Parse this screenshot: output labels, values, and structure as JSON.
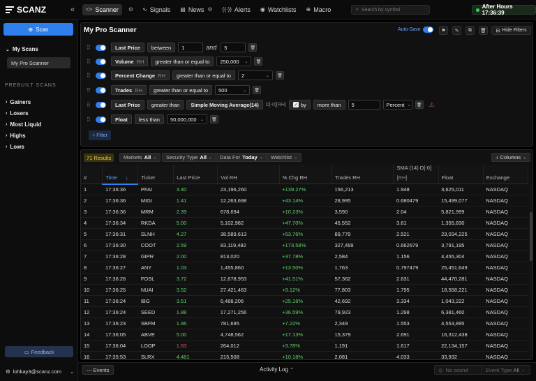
{
  "app": {
    "logo": "SCANZ"
  },
  "nav": [
    {
      "label": "Scanner",
      "icon": "code-icon",
      "active": true
    },
    {
      "label": "Signals",
      "icon": "pulse-icon"
    },
    {
      "label": "News",
      "icon": "news-icon"
    },
    {
      "label": "Alerts",
      "icon": "broadcast-icon"
    },
    {
      "label": "Watchlists",
      "icon": "eye-icon"
    },
    {
      "label": "Macro",
      "icon": "globe-icon"
    }
  ],
  "search": {
    "placeholder": "Search by symbol"
  },
  "market_status": "After Hours 17:36:39",
  "sidebar": {
    "scan_button": "Scan",
    "my_scans_label": "My Scans",
    "my_scans": [
      "My Pro Scanner"
    ],
    "prebuilt_label": "PREBUILT SCANS",
    "prebuilt": [
      "Gainers",
      "Losers",
      "Most Liquid",
      "Highs",
      "Lows"
    ],
    "feedback": "Feedback",
    "user_email": "lohkay3@scanz.com"
  },
  "scanner": {
    "title": "My Pro Scanner",
    "autosave_label": "Auto-Save",
    "hide_filters": "Hide Filters",
    "add_filter": "+ Filter",
    "filters": {
      "f1": {
        "field": "Last Price",
        "op": "between",
        "v1": "1",
        "and": "and",
        "v2": "5"
      },
      "f2": {
        "field": "Volume",
        "rh": "RH",
        "op": "greater than or equal to",
        "v1": "250,000"
      },
      "f3": {
        "field": "Percent Change",
        "rh": "RH",
        "op": "greater than or equal to",
        "v1": "2"
      },
      "f4": {
        "field": "Trades",
        "rh": "RH",
        "op": "greater than or equal to",
        "v1": "500"
      },
      "f5": {
        "field": "Last Price",
        "op": "greater than",
        "ind": "Simple Moving Average(14)",
        "ind_sub": "D[-0][RH]",
        "by": "by",
        "op2": "more than",
        "v1": "5",
        "unit": "Percent"
      },
      "f6": {
        "field": "Float",
        "op": "less than",
        "v1": "50,000,000"
      }
    }
  },
  "results": {
    "count_label": "71 Results",
    "chips": {
      "markets": {
        "label": "Markets",
        "value": "All"
      },
      "security": {
        "label": "Security Type",
        "value": "All"
      },
      "datafor": {
        "label": "Data For",
        "value": "Today"
      },
      "watchlist": {
        "label": "Watchlist",
        "value": ""
      }
    },
    "columns_btn": "Columns",
    "headers": {
      "num": "#",
      "time": "Time",
      "ticker": "Ticker",
      "last": "Last Price",
      "vol": "Vol RH",
      "pct": "% Chg RH",
      "trades": "Trades RH",
      "sma": "SMA (14) D[-0]",
      "sma_sub": "[RH]",
      "float": "Float",
      "exchange": "Exchange"
    },
    "rows": [
      [
        "1",
        "17:36:36",
        "PFAI",
        "3.40",
        "23,196,260",
        "+139.27%",
        "156,213",
        "1.948",
        "3,625,011",
        "NASDAQ"
      ],
      [
        "2",
        "17:36:36",
        "MIGI",
        "1.41",
        "12,263,698",
        "+43.14%",
        "28,995",
        "0.680479",
        "15,499,077",
        "NASDAQ"
      ],
      [
        "3",
        "17:36:36",
        "MRM",
        "2.39",
        "678,694",
        "+10.23%",
        "3,590",
        "2.04",
        "5,821,999",
        "NASDAQ"
      ],
      [
        "4",
        "17:36:34",
        "RKDA",
        "5.00",
        "5,102,982",
        "+47.70%",
        "45,552",
        "3.61",
        "1,355,830",
        "NASDAQ"
      ],
      [
        "5",
        "17:36:31",
        "SLNH",
        "4.27",
        "38,589,613",
        "+53.76%",
        "89,779",
        "2.521",
        "23,034,225",
        "NASDAQ"
      ],
      [
        "6",
        "17:36:30",
        "COOT",
        "2.59",
        "83,119,482",
        "+173.58%",
        "327,499",
        "0.662679",
        "3,791,195",
        "NASDAQ"
      ],
      [
        "7",
        "17:36:28",
        "GIPR",
        "2.00",
        "813,020",
        "+37.78%",
        "2,584",
        "1.156",
        "4,455,304",
        "NASDAQ"
      ],
      [
        "8",
        "17:36:27",
        "ANY",
        "1.03",
        "1,455,860",
        "+13.50%",
        "1,763",
        "0.797479",
        "25,451,649",
        "NASDAQ"
      ],
      [
        "9",
        "17:36:26",
        "FOSL",
        "3.72",
        "12,678,953",
        "+41.51%",
        "57,362",
        "2.631",
        "44,470,281",
        "NASDAQ"
      ],
      [
        "10",
        "17:36:25",
        "NUAI",
        "3.52",
        "27,421,463",
        "+9.12%",
        "77,803",
        "1.795",
        "18,558,221",
        "NASDAQ"
      ],
      [
        "11",
        "17:36:24",
        "IBG",
        "3.51",
        "6,488,206",
        "+25.16%",
        "42,692",
        "3.334",
        "1,043,222",
        "NASDAQ"
      ],
      [
        "12",
        "17:36:24",
        "SEED",
        "1.88",
        "17,271,256",
        "+36.59%",
        "79,923",
        "1.298",
        "6,381,460",
        "NASDAQ"
      ],
      [
        "13",
        "17:36:23",
        "SBFM",
        "1.96",
        "781,695",
        "+7.22%",
        "2,349",
        "1.553",
        "4,553,895",
        "NASDAQ"
      ],
      [
        "14",
        "17:36:05",
        "ABVE",
        "5.00",
        "4,748,562",
        "+17.13%",
        "15,379",
        "2.691",
        "16,312,438",
        "NASDAQ"
      ],
      [
        "15",
        "17:36:04",
        "LOOP",
        "1.83",
        "264,012",
        "+3.78%",
        "1,191",
        "1.617",
        "22,134,157",
        "NASDAQ"
      ],
      [
        "16",
        "17:35:53",
        "SLRX",
        "4.481",
        "215,508",
        "+10.18%",
        "2,081",
        "4.033",
        "33,932",
        "NASDAQ"
      ]
    ],
    "last_price_colors": [
      "pos",
      "pos",
      "pos",
      "pos",
      "pos",
      "pos",
      "pos",
      "pos",
      "pos",
      "pos",
      "pos",
      "pos",
      "pos",
      "pos",
      "neg",
      "pos"
    ]
  },
  "bottom": {
    "events": "--- Events",
    "activity_log": "Activity Log",
    "no_sound": "No sound",
    "event_type_label": "Event Type",
    "event_type_value": "All"
  },
  "colors": {
    "accent": "#2f80ed",
    "positive": "#5fd36c",
    "negative": "#e05252",
    "results_badge": "#e6c94a"
  }
}
